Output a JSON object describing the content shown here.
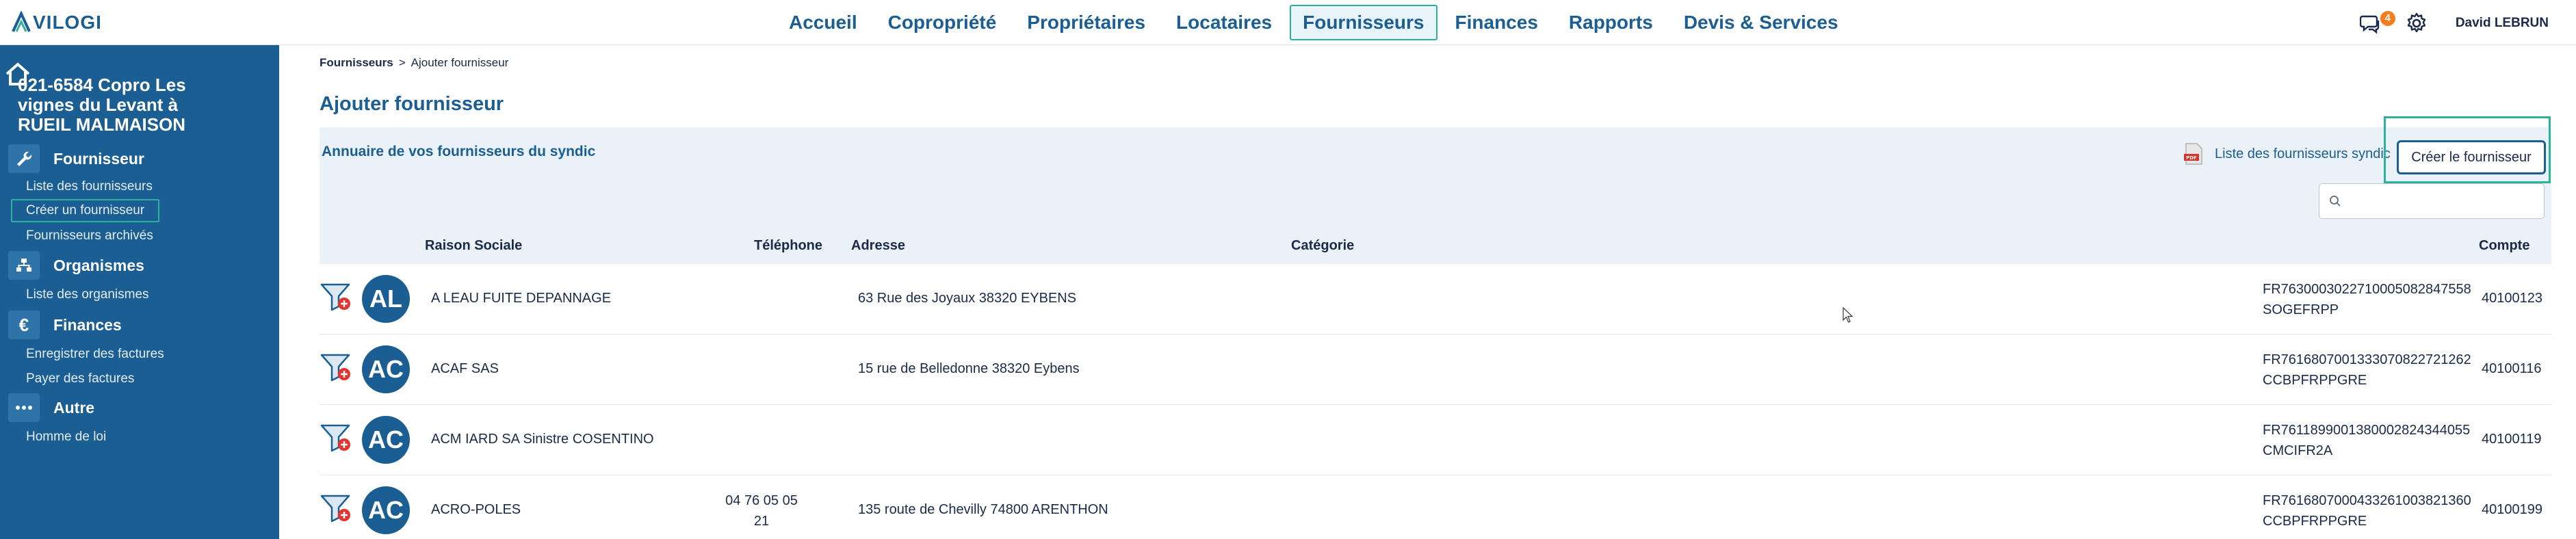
{
  "app": {
    "logo_text": "VILOGI",
    "nav": [
      {
        "label": "Accueil",
        "active": false
      },
      {
        "label": "Copropriété",
        "active": false
      },
      {
        "label": "Propriétaires",
        "active": false
      },
      {
        "label": "Locataires",
        "active": false
      },
      {
        "label": "Fournisseurs",
        "active": true
      },
      {
        "label": "Finances",
        "active": false
      },
      {
        "label": "Rapports",
        "active": false
      },
      {
        "label": "Devis & Services",
        "active": false
      }
    ],
    "notification_count": "4",
    "user_name": "David LEBRUN",
    "colors": {
      "brand": "#1a5e93",
      "accent": "#2ab39a",
      "badge": "#f47d20"
    }
  },
  "sidebar": {
    "property_title": "021-6584 Copro Les vignes du Levant à RUEIL MALMAISON",
    "sections": [
      {
        "label": "Fournisseur",
        "icon": "wrench-icon",
        "links": [
          "Liste des fournisseurs",
          "Créer un fournisseur",
          "Fournisseurs archivés"
        ]
      },
      {
        "label": "Organismes",
        "icon": "org-chart-icon",
        "links": [
          "Liste des organismes"
        ]
      },
      {
        "label": "Finances",
        "icon": "euro-icon",
        "links": [
          "Enregistrer des factures",
          "Payer des factures"
        ]
      },
      {
        "label": "Autre",
        "icon": "more-dots-icon",
        "links": [
          "Homme de loi"
        ]
      }
    ],
    "active_link": "Créer un fournisseur"
  },
  "breadcrumb": {
    "parent": "Fournisseurs",
    "separator": ">",
    "current": "Ajouter fournisseur"
  },
  "page_title": "Ajouter fournisseur",
  "panel": {
    "title": "Annuaire de vos fournisseurs du syndic",
    "pdf_link": "Liste des fournisseurs syndic",
    "create_button": "Créer le fournisseur",
    "search_placeholder": ""
  },
  "table": {
    "headers": {
      "name": "Raison Sociale",
      "phone": "Téléphone",
      "address": "Adresse",
      "category": "Catégorie",
      "account": "Compte"
    },
    "rows": [
      {
        "initials": "AL",
        "name": "A LEAU FUITE DEPANNAGE",
        "phone1": "",
        "phone2": "",
        "address": "63 Rue des Joyaux 38320 EYBENS",
        "category": "",
        "iban": "FR7630003022710005082847558",
        "bic": "SOGEFRPP",
        "account": "40100123"
      },
      {
        "initials": "AC",
        "name": "ACAF SAS",
        "phone1": "",
        "phone2": "",
        "address": "15 rue de Belledonne 38320 Eybens",
        "category": "",
        "iban": "FR7616807001333070822721262",
        "bic": "CCBPFRPPGRE",
        "account": "40100116"
      },
      {
        "initials": "AC",
        "name": "ACM IARD SA Sinistre COSENTINO",
        "phone1": "",
        "phone2": "",
        "address": "",
        "category": "",
        "iban": "FR7611899001380002824344055",
        "bic": "CMCIFR2A",
        "account": "40100119"
      },
      {
        "initials": "AC",
        "name": "ACRO-POLES",
        "phone1": "04 76 05 05",
        "phone2": "21",
        "address": "135 route de Chevilly 74800 ARENTHON",
        "category": "",
        "iban": "FR7616807000433261003821360",
        "bic": "CCBPFRPPGRE",
        "account": "40100199"
      }
    ]
  }
}
